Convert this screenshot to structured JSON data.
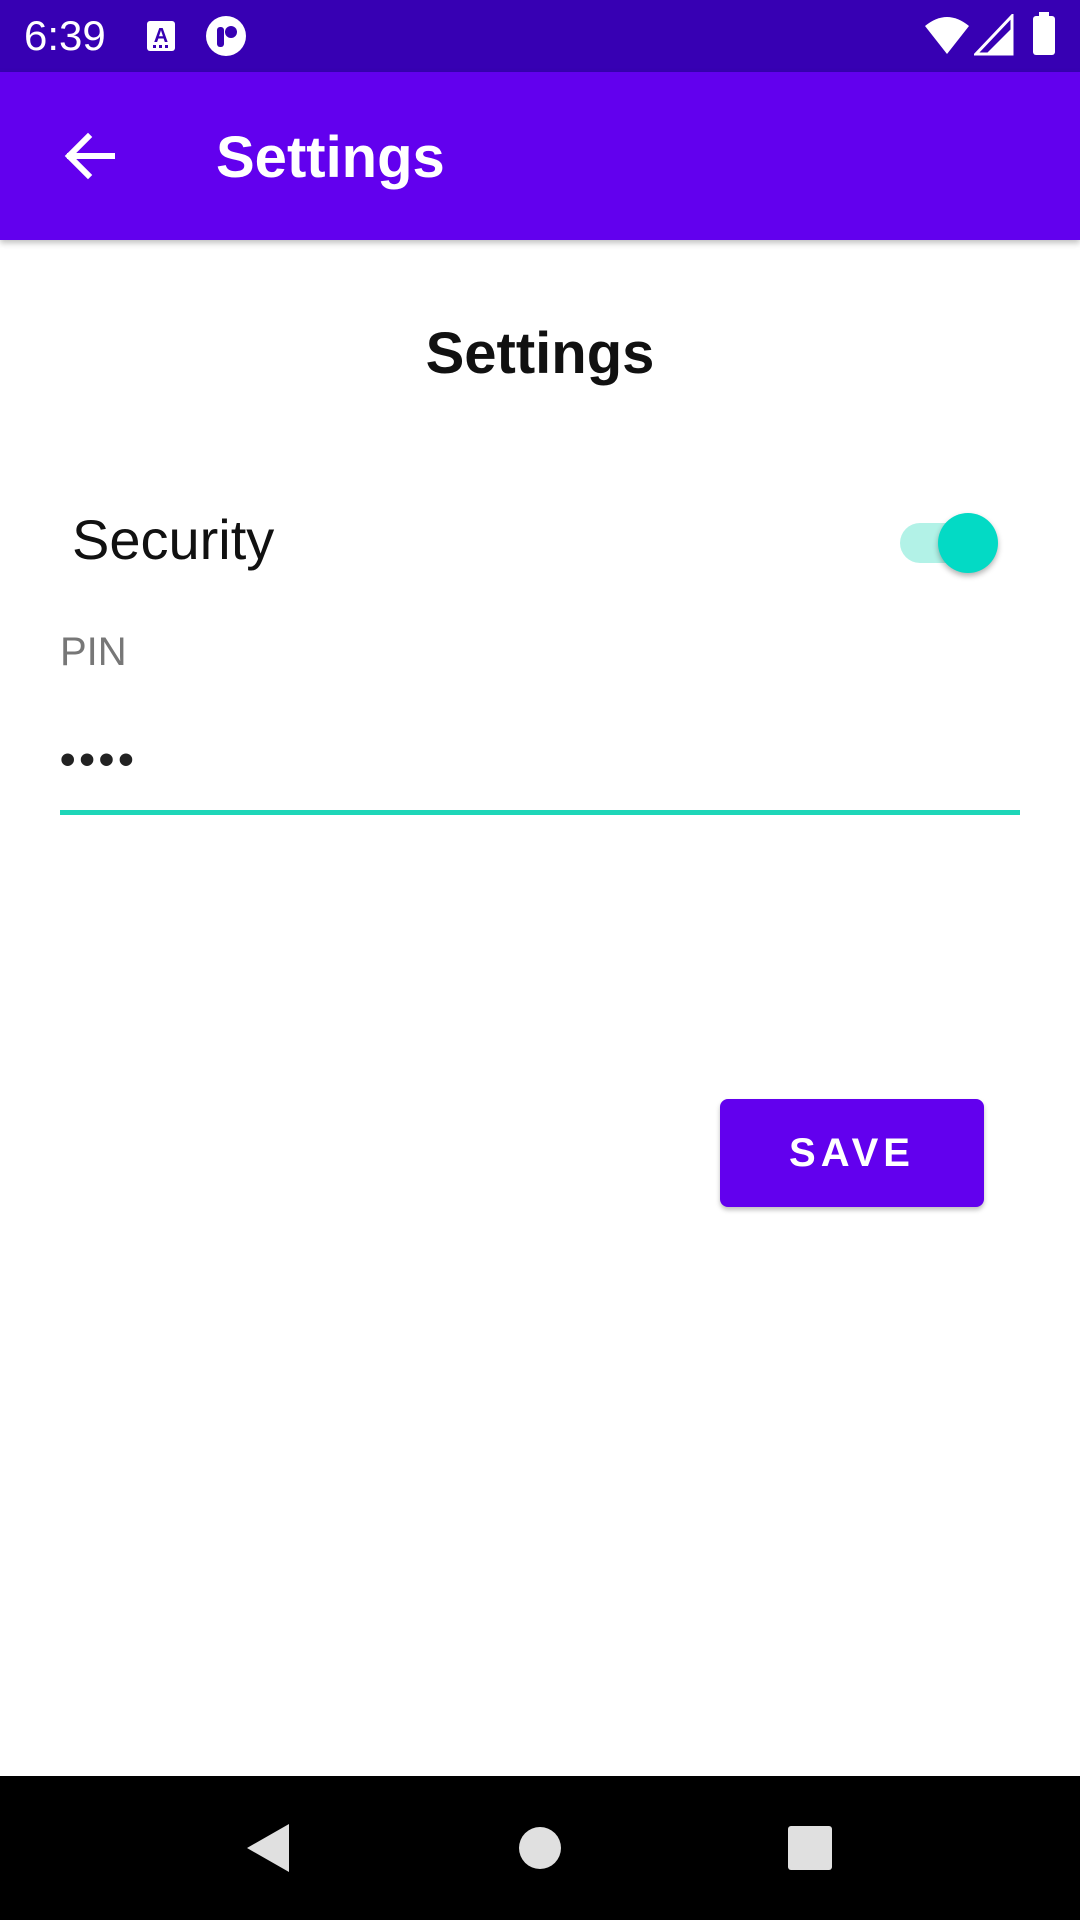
{
  "status_bar": {
    "time": "6:39",
    "icons": [
      "keyboard-a-icon",
      "circle-app-icon",
      "wifi-icon",
      "cell-signal-icon",
      "battery-icon"
    ]
  },
  "app_bar": {
    "title": "Settings",
    "back_icon": "arrow-back-icon",
    "color": "#6200ee"
  },
  "main": {
    "heading": "Settings",
    "security": {
      "label": "Security",
      "enabled": true,
      "accent": "#03dac5"
    },
    "pin": {
      "label": "PIN",
      "value": "••••"
    },
    "save_label": "SAVE"
  },
  "nav_bar": {
    "buttons": [
      "back-triangle-icon",
      "home-circle-icon",
      "recents-square-icon"
    ]
  }
}
